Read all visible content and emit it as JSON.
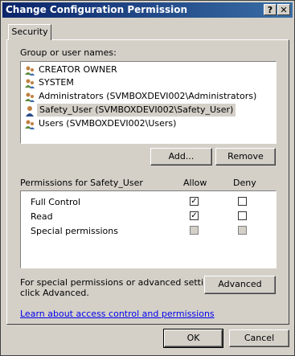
{
  "window": {
    "title": "Change Configuration Permission"
  },
  "titlebar": {
    "help": "?",
    "close": "✕"
  },
  "tabs": [
    {
      "label": "Security"
    }
  ],
  "users": {
    "label": "Group or user names:",
    "items": [
      {
        "name": "CREATOR OWNER",
        "icon": "group-icon"
      },
      {
        "name": "SYSTEM",
        "icon": "group-icon"
      },
      {
        "name": "Administrators (SVMBOXDEVI002\\Administrators)",
        "icon": "group-icon"
      },
      {
        "name": "Safety_User (SVMBOXDEVI002\\Safety_User)",
        "icon": "user-icon",
        "selected": true
      },
      {
        "name": "Users (SVMBOXDEVI002\\Users)",
        "icon": "group-icon"
      }
    ],
    "add_label": "Add...",
    "remove_label": "Remove"
  },
  "permissions": {
    "header": "Permissions for Safety_User",
    "allow_header": "Allow",
    "deny_header": "Deny",
    "rows": [
      {
        "name": "Full Control",
        "allow": true,
        "deny": false,
        "disabled": false
      },
      {
        "name": "Read",
        "allow": true,
        "deny": false,
        "disabled": false
      },
      {
        "name": "Special permissions",
        "allow": false,
        "deny": false,
        "disabled": true
      }
    ]
  },
  "advanced": {
    "text_line1": "For special permissions or advanced settings,",
    "text_line2": "click Advanced.",
    "button": "Advanced"
  },
  "learn_link": "Learn about access control and permissions",
  "footer": {
    "ok": "OK",
    "cancel": "Cancel"
  },
  "check_mark": "✓"
}
